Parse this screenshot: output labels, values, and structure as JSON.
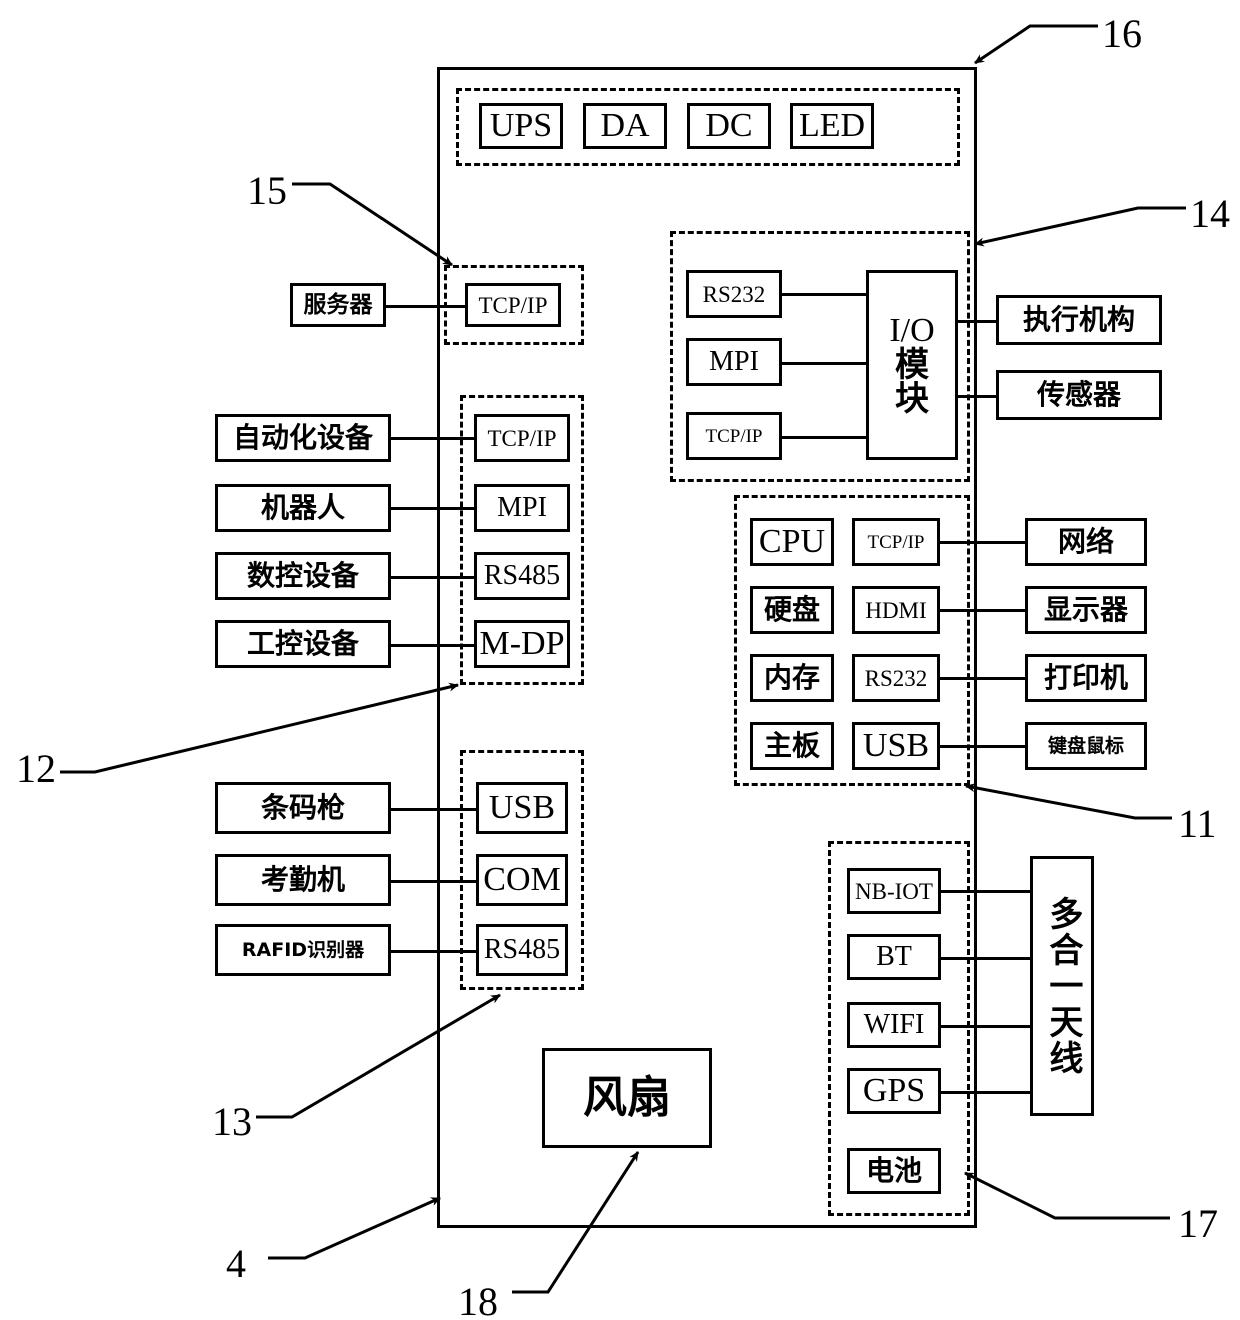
{
  "diagram": {
    "title": "Industrial gateway / edge controller block diagram",
    "enclosure_label": "4",
    "ref_numbers": [
      "16",
      "15",
      "14",
      "12",
      "11",
      "13",
      "17",
      "4",
      "18"
    ]
  },
  "power_group": {
    "ref": "16",
    "items": [
      {
        "label": "UPS"
      },
      {
        "label": "DA"
      },
      {
        "label": "DC"
      },
      {
        "label": "LED"
      }
    ]
  },
  "server_group": {
    "ref": "15",
    "external": {
      "label": "服务器"
    },
    "port": {
      "label": "TCP/IP"
    }
  },
  "fieldbus_group": {
    "ref": "12",
    "rows": [
      {
        "device": "自动化设备",
        "port": "TCP/IP"
      },
      {
        "device": "机器人",
        "port": "MPI"
      },
      {
        "device": "数控设备",
        "port": "RS485"
      },
      {
        "device": "工控设备",
        "port": "M-DP"
      }
    ]
  },
  "peripheral_group": {
    "ref": "13",
    "rows": [
      {
        "device": "条码枪",
        "port": "USB"
      },
      {
        "device": "考勤机",
        "port": "COM"
      },
      {
        "device": "RAFID识别器",
        "port": "RS485"
      }
    ]
  },
  "io_group": {
    "ref": "14",
    "ports": [
      {
        "label": "RS232"
      },
      {
        "label": "MPI"
      },
      {
        "label": "TCP/IP"
      }
    ],
    "module": {
      "label": "I/O模块",
      "line1": "I/O",
      "line2": "模",
      "line3": "块"
    },
    "outputs": [
      {
        "label": "执行机构"
      },
      {
        "label": "传感器"
      }
    ]
  },
  "computer_group": {
    "ref": "11",
    "rows": [
      {
        "component": "CPU",
        "port": "TCP/IP",
        "device": "网络"
      },
      {
        "component": "硬盘",
        "port": "HDMI",
        "device": "显示器"
      },
      {
        "component": "内存",
        "port": "RS232",
        "device": "打印机"
      },
      {
        "component": "主板",
        "port": "USB",
        "device": "键盘鼠标"
      }
    ]
  },
  "wireless_group": {
    "ref": "17",
    "modules": [
      {
        "label": "NB-IOT"
      },
      {
        "label": "BT"
      },
      {
        "label": "WIFI"
      },
      {
        "label": "GPS"
      },
      {
        "label": "电池"
      }
    ],
    "antenna": {
      "label": "多合一天线"
    }
  },
  "fan": {
    "ref": "18",
    "label": "风扇"
  }
}
